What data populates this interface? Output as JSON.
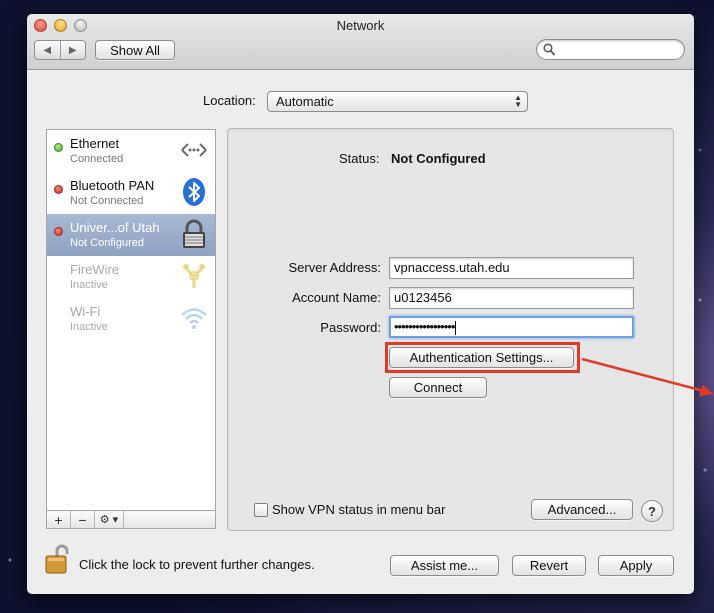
{
  "window": {
    "title": "Network",
    "show_all_label": "Show All",
    "search_placeholder": ""
  },
  "location": {
    "label": "Location:",
    "value": "Automatic"
  },
  "services": [
    {
      "name": "Ethernet",
      "status": "Connected",
      "dot": "green",
      "icon": "ethernet-icon"
    },
    {
      "name": "Bluetooth PAN",
      "status": "Not Connected",
      "dot": "red",
      "icon": "bluetooth-icon"
    },
    {
      "name": "Univer...of Utah",
      "status": "Not Configured",
      "dot": "red",
      "icon": "vpn-lock-icon",
      "selected": true
    },
    {
      "name": "FireWire",
      "status": "Inactive",
      "icon": "firewire-icon",
      "inactive": true
    },
    {
      "name": "Wi-Fi",
      "status": "Inactive",
      "icon": "wifi-icon",
      "inactive": true
    }
  ],
  "sidebar_toolbar": {
    "add": "+",
    "remove": "−",
    "gear": "⚙ ▾"
  },
  "detail": {
    "status_label": "Status:",
    "status_value": "Not Configured",
    "server_label": "Server Address:",
    "server_value": "vpnaccess.utah.edu",
    "account_label": "Account Name:",
    "account_value": "u0123456",
    "password_label": "Password:",
    "password_value": "•••••••••••••••••",
    "auth_button": "Authentication Settings...",
    "connect_button": "Connect",
    "show_vpn_label": "Show VPN status in menu bar",
    "show_vpn_checked": false,
    "advanced_button": "Advanced...",
    "help": "?"
  },
  "footer": {
    "lock_text": "Click the lock to prevent further changes.",
    "assist_button": "Assist me...",
    "revert_button": "Revert",
    "apply_button": "Apply"
  },
  "annotation": {
    "color": "#e23a27"
  }
}
